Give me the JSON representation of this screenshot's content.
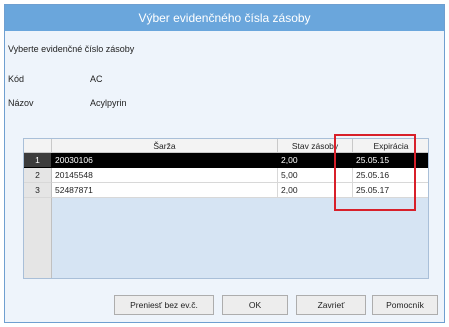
{
  "window": {
    "title": "Výber evidenčného čísla zásoby"
  },
  "dialog": {
    "subtitle": "Vyberte evidenčné číslo zásoby",
    "kod_label": "Kód",
    "kod_value": "AC",
    "nazov_label": "Názov",
    "nazov_value": "Acylpyrin"
  },
  "grid": {
    "columns": [
      "",
      "Šarža",
      "Stav zásoby",
      "Expirácia"
    ],
    "rows": [
      {
        "num": "1",
        "sarza": "20030106",
        "stav": "2,00",
        "expiracia": "25.05.15",
        "selected": true
      },
      {
        "num": "2",
        "sarza": "20145548",
        "stav": "5,00",
        "expiracia": "25.05.16",
        "selected": false
      },
      {
        "num": "3",
        "sarza": "52487871",
        "stav": "2,00",
        "expiracia": "25.05.17",
        "selected": false
      }
    ]
  },
  "buttons": {
    "prenest": "Preniesť bez ev.č.",
    "ok": "OK",
    "zavriet": "Zavrieť",
    "pomocnik": "Pomocník"
  },
  "colors": {
    "titlebar": "#6aa6dc",
    "selected_row": "#000000",
    "highlight": "#d8202a",
    "grid_bg": "#d6e4f3"
  }
}
